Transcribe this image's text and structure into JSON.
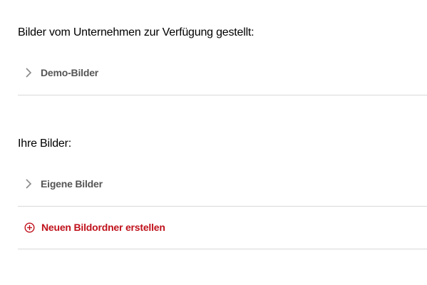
{
  "company_section": {
    "title": "Bilder vom Unternehmen zur Verfügung gestellt:",
    "folders": [
      {
        "label": "Demo-Bilder",
        "icon": "chevron-right-icon"
      }
    ]
  },
  "own_section": {
    "title": "Ihre Bilder:",
    "folders": [
      {
        "label": "Eigene Bilder",
        "icon": "chevron-right-icon"
      }
    ],
    "create_folder": {
      "label": "Neuen Bildordner erstellen",
      "icon": "plus-circle-icon"
    }
  },
  "colors": {
    "accent": "#c0121c",
    "folder_text": "#555555",
    "divider": "#d9d9d9"
  }
}
